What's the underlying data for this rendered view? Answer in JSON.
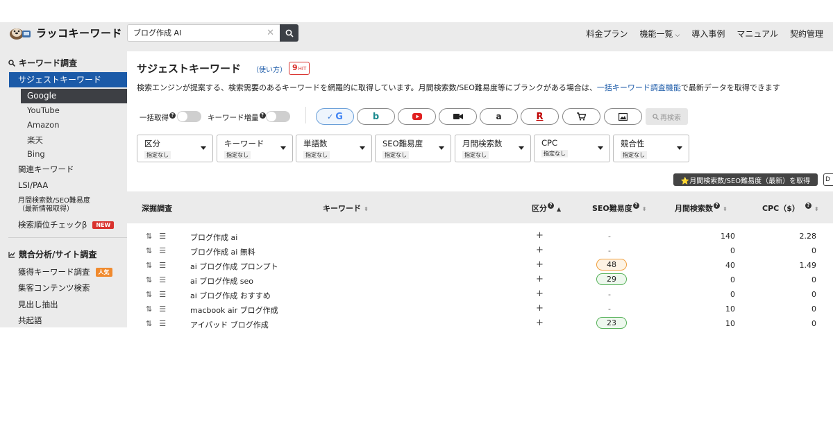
{
  "header": {
    "logo_text": "ラッコキーワード",
    "search_value": "ブログ作成 AI",
    "nav": [
      "料金プラン",
      "機能一覧",
      "導入事例",
      "マニュアル",
      "契約管理"
    ]
  },
  "sidebar": {
    "section1": "キーワード調査",
    "suggest": "サジェストキーワード",
    "engines": [
      "Google",
      "YouTube",
      "Amazon",
      "楽天",
      "Bing"
    ],
    "related": "関連キーワード",
    "lsi": "LSI/PAA",
    "monthly_line1": "月間検索数/SEO難易度",
    "monthly_line2": "（最新情報取得）",
    "rank_check": "検索順位チェックβ",
    "new_badge": "NEW",
    "section2": "競合分析/サイト調査",
    "acquired": "獲得キーワード調査",
    "popular_badge": "人気",
    "content_search": "集客コンテンツ検索",
    "headings": "見出し抽出",
    "cooccur": "共起語"
  },
  "main": {
    "title": "サジェストキーワード",
    "usage": "（使い方）",
    "hit_count": "9",
    "hit_label": "HIT",
    "desc_before": "検索エンジンが提案する、検索需要のあるキーワードを網羅的に取得しています。月間検索数/SEO難易度等にブランクがある場合は、",
    "desc_link": "一括キーワード調査機能",
    "desc_after": "で最新データを取得できます",
    "toggle1": "一括取得",
    "toggle2": "キーワード増量",
    "research": "再検索",
    "filters": [
      {
        "label": "区分",
        "value": "指定なし"
      },
      {
        "label": "キーワード",
        "value": "指定なし"
      },
      {
        "label": "単語数",
        "value": "指定なし"
      },
      {
        "label": "SEO難易度",
        "value": "指定なし"
      },
      {
        "label": "月間検索数",
        "value": "指定なし"
      },
      {
        "label": "CPC",
        "value": "指定なし"
      },
      {
        "label": "競合性",
        "value": "指定なし"
      }
    ],
    "fetch_button": "⭐月間検索数/SEO難易度（最新）を取得",
    "fetch_button2": "D"
  },
  "table": {
    "headers": {
      "dig": "深掘調査",
      "keyword": "キーワード",
      "category": "区分",
      "seo": "SEO難易度",
      "volume": "月間検索数",
      "cpc": "CPC（$）"
    },
    "rows": [
      {
        "keyword": "ブログ作成 ai",
        "seo": "-",
        "volume": "140",
        "cpc": "2.28"
      },
      {
        "keyword": "ブログ作成 ai 無料",
        "seo": "-",
        "volume": "0",
        "cpc": "0"
      },
      {
        "keyword": "ai ブログ作成 プロンプト",
        "seo": "48",
        "volume": "40",
        "cpc": "1.49"
      },
      {
        "keyword": "ai ブログ作成 seo",
        "seo": "29",
        "volume": "0",
        "cpc": "0"
      },
      {
        "keyword": "ai ブログ作成 おすすめ",
        "seo": "-",
        "volume": "0",
        "cpc": "0"
      },
      {
        "keyword": "macbook air ブログ作成",
        "seo": "-",
        "volume": "10",
        "cpc": "0"
      },
      {
        "keyword": "アイパッド ブログ作成",
        "seo": "23",
        "volume": "10",
        "cpc": "0"
      }
    ]
  },
  "colors": {
    "accent": "#1b5aa8",
    "active_dark": "#3d3f44",
    "badge_red": "#d9322e",
    "badge_orange": "#f08a2e",
    "pill_orange": "#f0a040",
    "pill_green": "#57b25a"
  }
}
